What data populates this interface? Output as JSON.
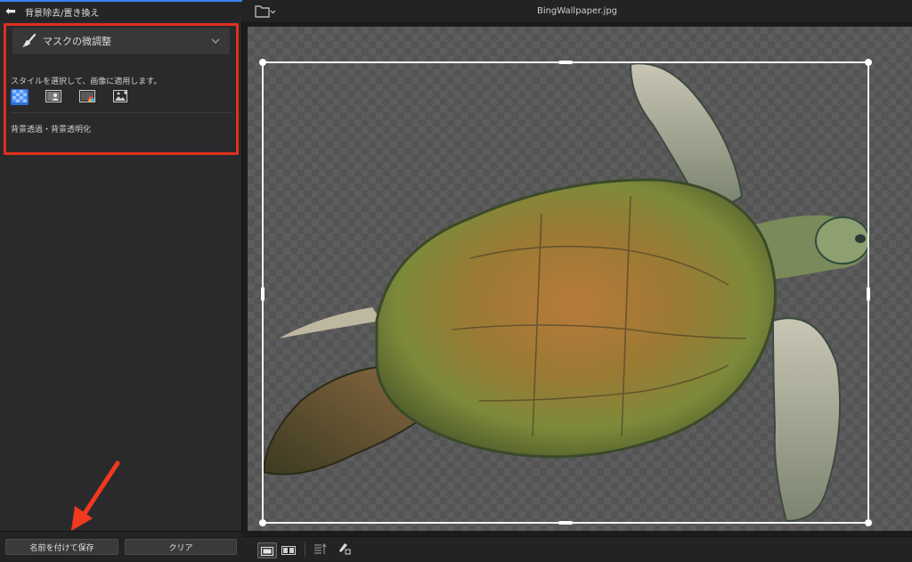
{
  "panel": {
    "back_glyph": "⬅",
    "title": "背景除去/置き換え"
  },
  "mask": {
    "label": "マスクの微調整",
    "icon": "brush-icon",
    "expand_icon": "chevron-down-icon"
  },
  "styles": {
    "instruction": "スタイルを選択して、画像に適用します。",
    "options": [
      {
        "icon": "transparent-checker-icon",
        "selected": true
      },
      {
        "icon": "portrait-background-icon",
        "selected": false
      },
      {
        "icon": "color-background-icon",
        "selected": false
      },
      {
        "icon": "image-background-icon",
        "selected": false
      }
    ],
    "selected_label": "背景透過・背景透明化"
  },
  "buttons": {
    "save_as": "名前を付けて保存",
    "clear": "クリア"
  },
  "document": {
    "file_name": "BingWallpaper.jpg",
    "folder_icon": "folder-icon"
  },
  "toolbar": {
    "tools": [
      "single-view-icon",
      "split-view-icon",
      "compare-icon",
      "brush-erase-icon"
    ]
  },
  "colors": {
    "accent": "#3b82f6",
    "highlight": "#e0301e"
  }
}
